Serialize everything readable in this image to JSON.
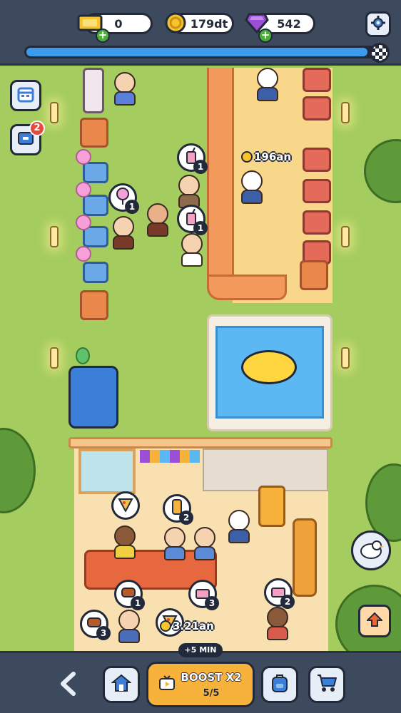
{
  "hud": {
    "tickets": {
      "value": "0",
      "icon": "ticket-icon"
    },
    "coins": {
      "value": "179dt",
      "icon": "coin-icon"
    },
    "gems": {
      "value": "542",
      "icon": "gem-icon"
    },
    "settings_icon": "gear-icon",
    "level_progress": 0.98
  },
  "side": {
    "calendar_icon": "calendar-icon",
    "inbox_icon": "inbox-icon",
    "inbox_badge": "2"
  },
  "world": {
    "orders": [
      {
        "item": "milkshake",
        "qty": "1"
      },
      {
        "item": "cotton-candy",
        "qty": "1"
      },
      {
        "item": "milkshake",
        "qty": "1"
      },
      {
        "item": "pizza",
        "qty": ""
      },
      {
        "item": "soda",
        "qty": "2"
      },
      {
        "item": "ribs",
        "qty": "1"
      },
      {
        "item": "cake",
        "qty": "3"
      },
      {
        "item": "cake",
        "qty": "2"
      },
      {
        "item": "ribs",
        "qty": "3"
      },
      {
        "item": "pizza",
        "qty": ""
      }
    ],
    "earnings_1": "196an",
    "earnings_2": "3.21an"
  },
  "bottom": {
    "back_icon": "chevron-left-icon",
    "home_icon": "house-icon",
    "boost_label": "BOOST X2",
    "boost_count": "5/5",
    "boost_tag": "+5 MIN",
    "backpack_icon": "backpack-icon",
    "cart_icon": "cart-icon",
    "up_icon": "arrow-up-icon"
  },
  "colors": {
    "hud_bg": "#3d4a5e",
    "grass": "#a4cc5e",
    "progress": "#3c9bea",
    "boost": "#f7b23c",
    "coin": "#f7c42a",
    "gem": "#9b4fd6"
  }
}
